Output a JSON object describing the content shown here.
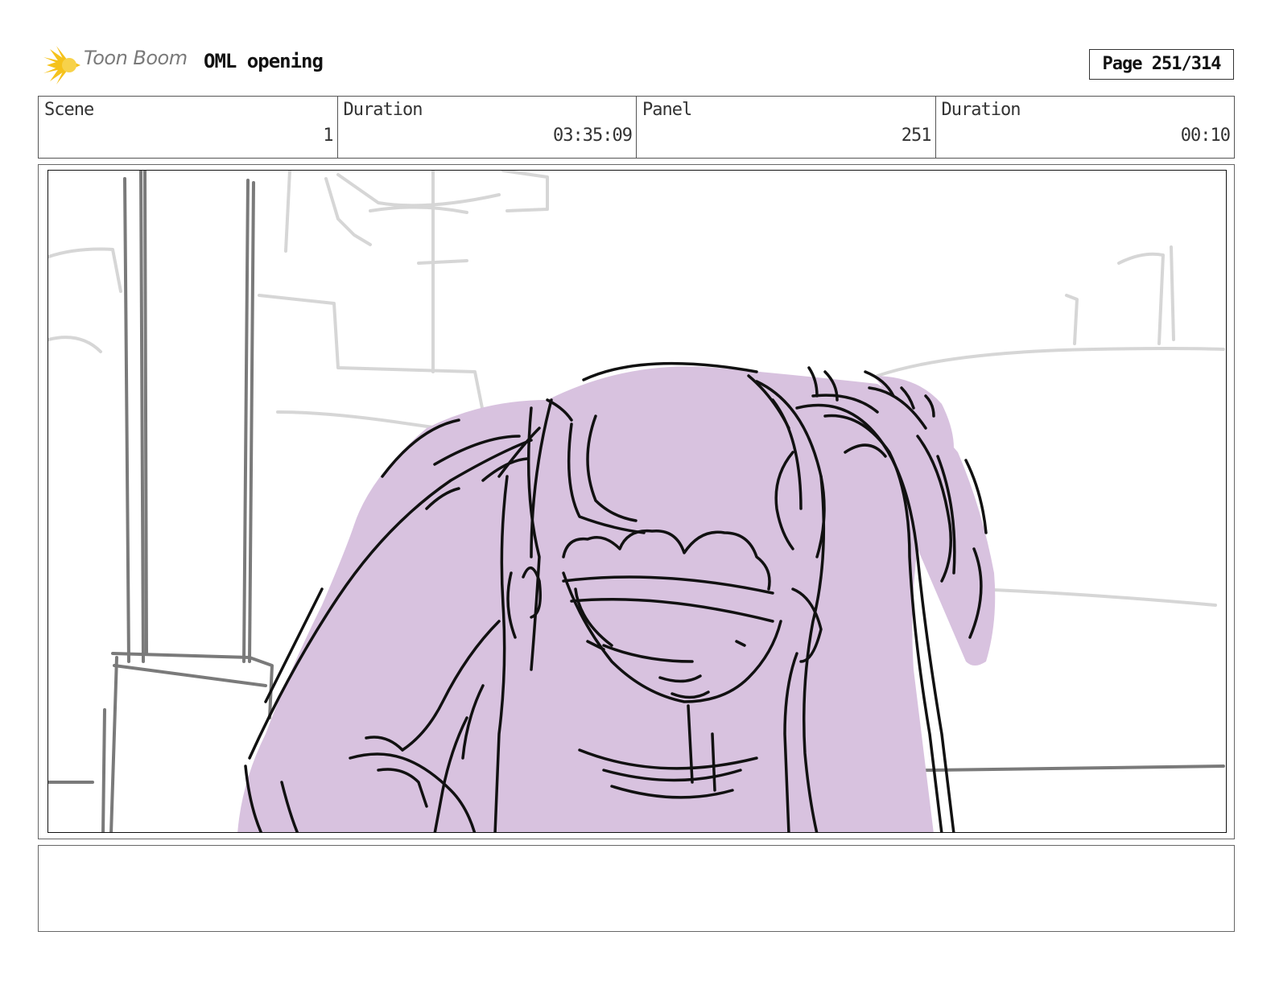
{
  "header": {
    "logo_text": "Toon Boom",
    "project_title": "OML opening",
    "page_label": "Page 251/314"
  },
  "info": {
    "scene_label": "Scene",
    "scene_value": "1",
    "scene_duration_label": "Duration",
    "scene_duration_value": "03:35:09",
    "panel_label": "Panel",
    "panel_value": "251",
    "panel_duration_label": "Duration",
    "panel_duration_value": "00:10"
  },
  "colors": {
    "character_fill": "#d8c2df",
    "background_lines": "#d6d6d6",
    "pillar_lines": "#7a7a7a",
    "ink": "#111111",
    "logo_flare": "#f5c21b"
  },
  "notes": ""
}
